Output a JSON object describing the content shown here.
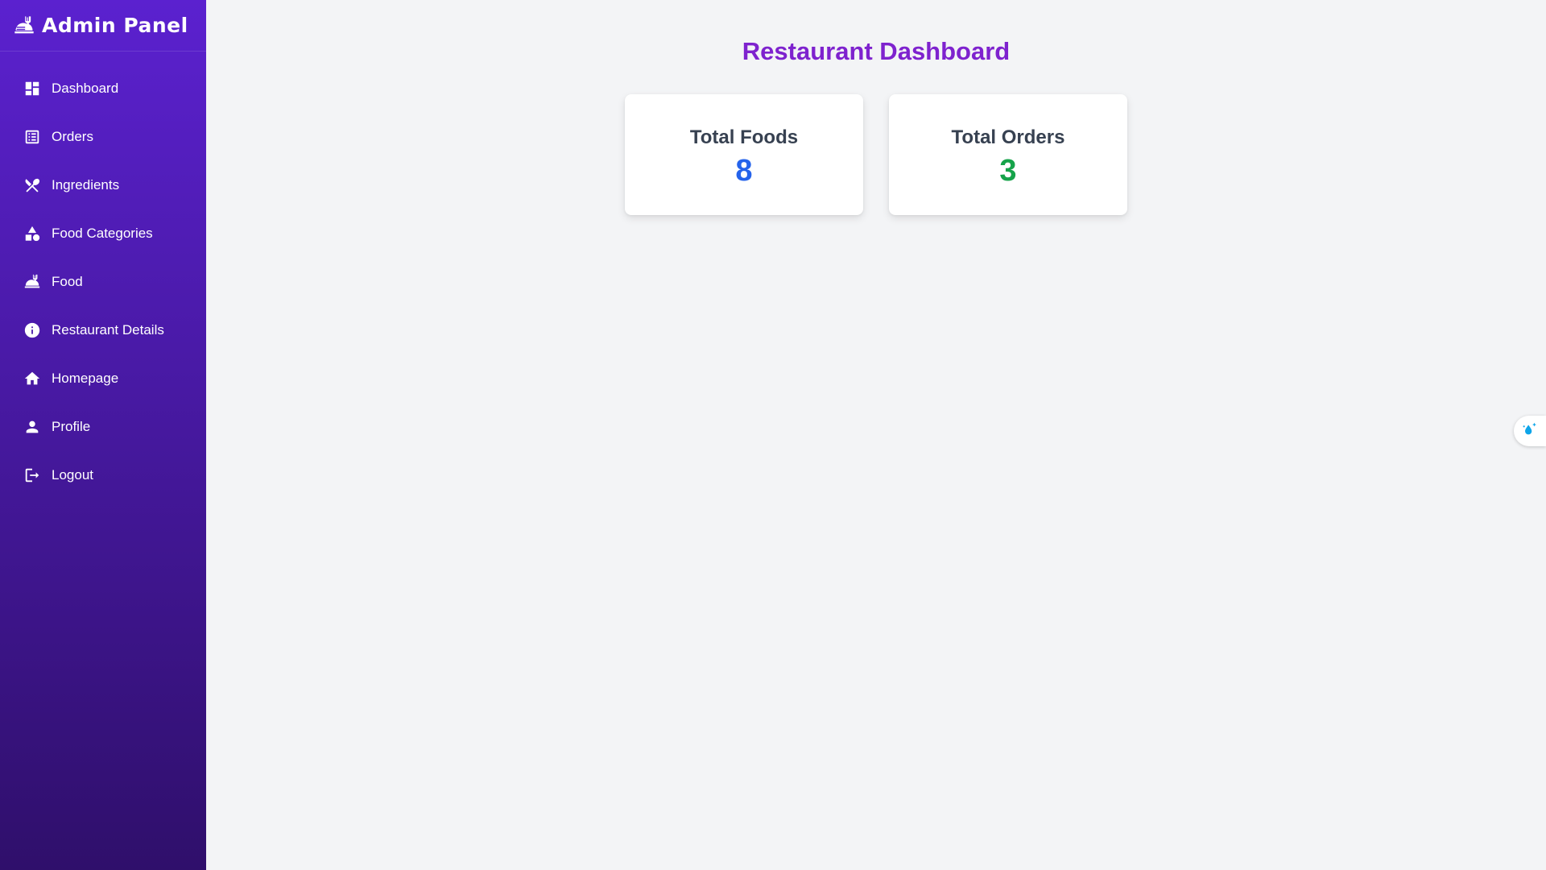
{
  "sidebar": {
    "title": "Admin Panel",
    "items": [
      {
        "label": "Dashboard",
        "icon": "dashboard-icon"
      },
      {
        "label": "Orders",
        "icon": "list-icon"
      },
      {
        "label": "Ingredients",
        "icon": "utensils-crossed-icon"
      },
      {
        "label": "Food Categories",
        "icon": "shapes-icon"
      },
      {
        "label": "Food",
        "icon": "food-cloche-icon"
      },
      {
        "label": "Restaurant Details",
        "icon": "info-icon"
      },
      {
        "label": "Homepage",
        "icon": "home-icon"
      },
      {
        "label": "Profile",
        "icon": "user-icon"
      },
      {
        "label": "Logout",
        "icon": "logout-icon"
      }
    ]
  },
  "main": {
    "title": "Restaurant Dashboard",
    "cards": [
      {
        "label": "Total Foods",
        "value": "8",
        "color": "#2563eb"
      },
      {
        "label": "Total Orders",
        "value": "3",
        "color": "#16a34a"
      }
    ]
  },
  "colors": {
    "sidebar_top": "#5b21cf",
    "sidebar_bottom": "#2f0f6b",
    "title": "#7e22ce",
    "background": "#f3f4f6"
  }
}
